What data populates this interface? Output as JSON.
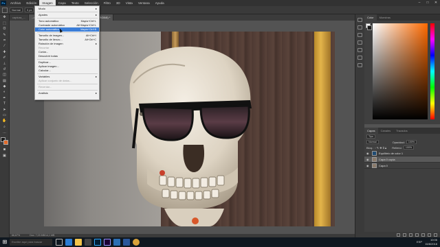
{
  "menubar": {
    "logo": "Ps",
    "items": [
      "Archivo",
      "Edición",
      "Imagen",
      "Capa",
      "Texto",
      "Selección",
      "Filtro",
      "3D",
      "Vista",
      "Ventana",
      "Ayuda"
    ],
    "active_index": 2
  },
  "options": {
    "mode_value": "Normal",
    "width_value": "0 px",
    "height_value": "0 px",
    "align_edges_label": "Alinear bordes"
  },
  "document_tabs": [
    {
      "label": "captura_...",
      "active": false
    },
    {
      "label": "...ustomen-MORRIS_1920.jpg al 66,7% (Capa 0 copia, RGB/8) *",
      "active": true
    }
  ],
  "image_menu": {
    "items": [
      {
        "label": "Modo",
        "submenu": true
      },
      {
        "label": "Ajustes",
        "submenu": true
      },
      {
        "label": "Tono automático",
        "shortcut": "Mayús+Ctrl+L"
      },
      {
        "label": "Contraste automático",
        "shortcut": "Alt+Mayús+Ctrl+L"
      },
      {
        "label": "Color automático",
        "shortcut": "Mayús+Ctrl+B",
        "highlighted": true
      },
      {
        "label": "Tamaño de imagen...",
        "shortcut": "Alt+Ctrl+I"
      },
      {
        "label": "Tamaño de lienzo...",
        "shortcut": "Alt+Ctrl+C"
      },
      {
        "label": "Rotación de imagen",
        "submenu": true
      },
      {
        "label": "Recortar",
        "disabled": true
      },
      {
        "label": "Cortar...",
        "disabled": false
      },
      {
        "label": "Descubrir todas"
      },
      {
        "label": "Duplicar..."
      },
      {
        "label": "Aplicar imagen..."
      },
      {
        "label": "Calcular..."
      },
      {
        "label": "Variables",
        "submenu": true
      },
      {
        "label": "Aplicar conjunto de datos...",
        "disabled": true
      },
      {
        "label": "Reventar...",
        "disabled": true
      },
      {
        "label": "Análisis",
        "submenu": true
      }
    ]
  },
  "statusbar": {
    "zoom": "66,67%",
    "doc_size": "Doc: 7,03 MB/14,1 MB"
  },
  "color_panel": {
    "tabs": [
      "Color",
      "Muestras"
    ],
    "foreground": "#ffffff",
    "background": "#1a1a1a"
  },
  "layers_panel": {
    "tabs": [
      "Capas",
      "Canales",
      "Trazados"
    ],
    "kind_filter": "Tipo",
    "blend_mode": "Normal",
    "opacity_label": "Opacidad:",
    "opacity_value": "100%",
    "lock_label": "Bloq.:",
    "fill_label": "Relleno:",
    "fill_value": "100%",
    "layers": [
      {
        "name": "Equilibrio de color 1",
        "selected": false,
        "visible": true
      },
      {
        "name": "Capa 0 copia",
        "selected": true,
        "visible": true
      },
      {
        "name": "Capa 0",
        "selected": false,
        "visible": true
      }
    ]
  },
  "taskbar": {
    "search_placeholder": "Escribe aquí para buscar",
    "lang": "ESP",
    "time": "10:06",
    "date": "15/8/2018"
  }
}
